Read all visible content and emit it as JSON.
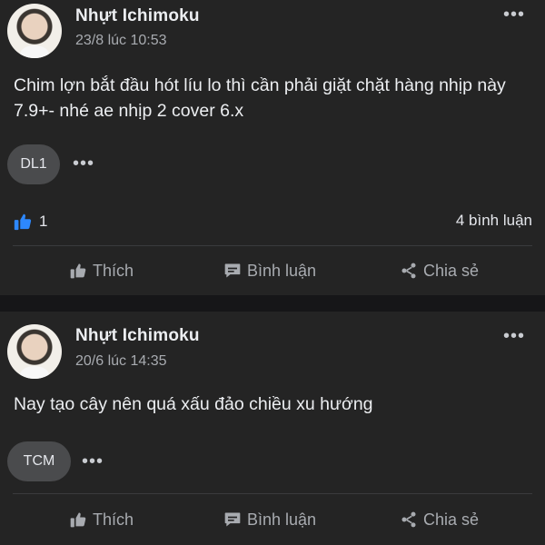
{
  "posts": [
    {
      "author": "Nhựt Ichimoku",
      "timestamp": "23/8 lúc 10:53",
      "content": "Chim lợn bắt đầu hót líu lo thì cần phải giặt chặt hàng nhịp này 7.9+- nhé ae nhịp 2 cover 6.x",
      "group_badge": "DL1",
      "like_count": "1",
      "comment_count": "4 bình luận",
      "actions": {
        "like": "Thích",
        "comment": "Bình luận",
        "share": "Chia sẻ"
      }
    },
    {
      "author": "Nhựt Ichimoku",
      "timestamp": "20/6 lúc 14:35",
      "content": "Nay tạo cây nên quá xấu đảo chiều xu hướng",
      "group_badge": "TCM",
      "actions": {
        "like": "Thích",
        "comment": "Bình luận",
        "share": "Chia sẻ"
      }
    }
  ],
  "icons": {
    "more": "more-dots-icon",
    "like": "thumbs-up-icon",
    "comment": "comment-icon",
    "share": "share-icon"
  },
  "colors": {
    "background": "#242424",
    "separator": "#161618",
    "like_blue": "#2d88ff",
    "muted_text": "#a8abb0"
  }
}
